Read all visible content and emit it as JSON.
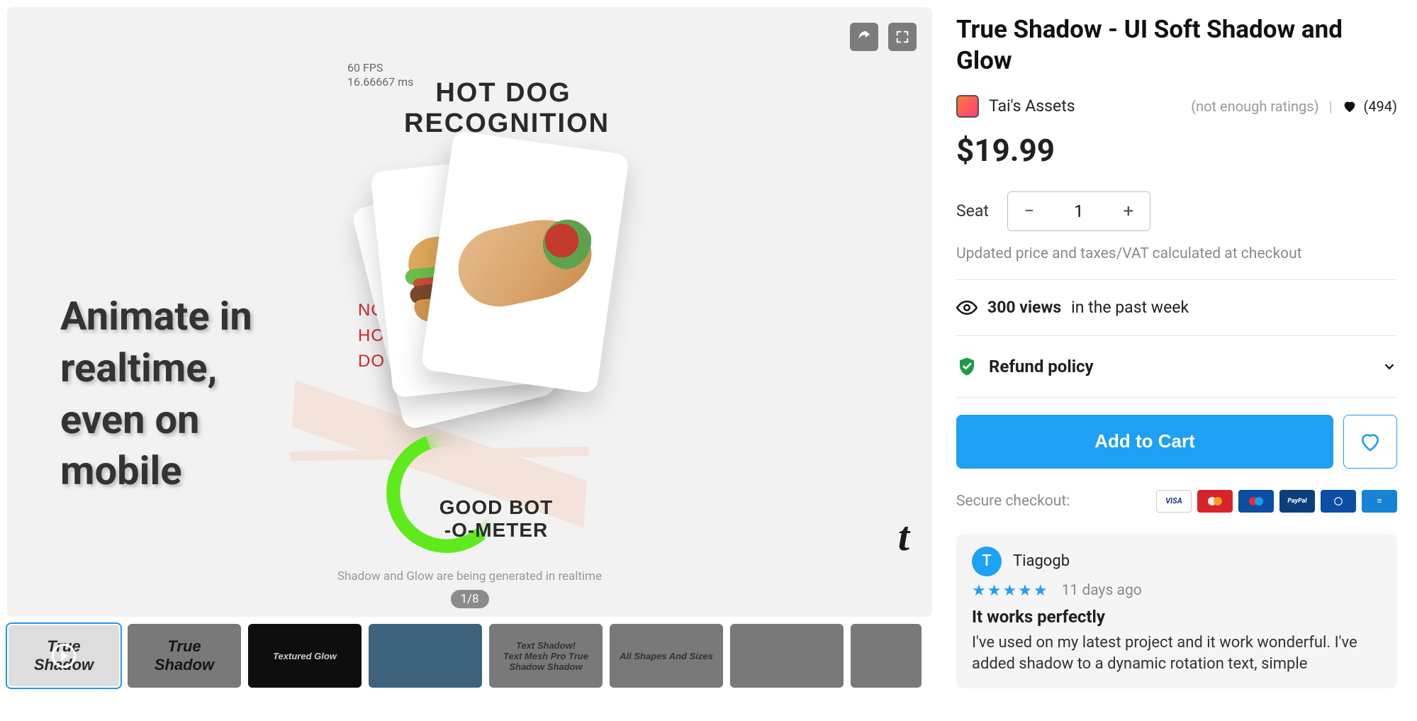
{
  "media": {
    "fps_line1": "60 FPS",
    "fps_line2": "16.66667 ms",
    "pixel_heading": "HOT DOG\nRECOGNITION\nTR",
    "overlay_heading": "Animate in\nrealtime,\neven on\nmobile",
    "red_labels": "NO\nHO\nDO",
    "gauge_label": "GOOD BOT\n-O-METER",
    "caption": "Shadow and Glow are being generated in realtime",
    "watermark": "t",
    "pager": "1/8",
    "share_icon": "share-icon",
    "fullscreen_icon": "fullscreen-icon"
  },
  "thumbnails": [
    {
      "label": "True\nShadow",
      "has_play": true,
      "active": true,
      "style": "light"
    },
    {
      "label": "True\nShadow",
      "has_play": false,
      "active": false,
      "style": "dim"
    },
    {
      "label": "Textured Glow",
      "has_play": false,
      "active": false,
      "style": "dark"
    },
    {
      "label": "",
      "has_play": false,
      "active": false,
      "style": "blue"
    },
    {
      "label": "Text Shadow!\nText Mesh Pro  True\nShadow  Shadow",
      "has_play": false,
      "active": false,
      "style": "dim"
    },
    {
      "label": "All Shapes And Sizes",
      "has_play": false,
      "active": false,
      "style": "dim"
    },
    {
      "label": "",
      "has_play": false,
      "active": false,
      "style": "dim"
    },
    {
      "label": "",
      "has_play": false,
      "active": false,
      "style": "dim-last"
    }
  ],
  "product": {
    "title": "True Shadow - UI Soft Shadow and Glow",
    "publisher": "Tai's Assets",
    "ratings_note": "(not enough ratings)",
    "favorites": "(494)",
    "price": "$19.99",
    "seat_label": "Seat",
    "seat_value": "1",
    "tax_note": "Updated price and taxes/VAT calculated at checkout",
    "views_count": "300 views",
    "views_suffix": "in the past week",
    "refund_label": "Refund policy",
    "add_to_cart": "Add to Cart",
    "secure_label": "Secure checkout:",
    "payment_methods": [
      "VISA",
      "mastercard",
      "maestro",
      "PayPal",
      "diners",
      "AMEX"
    ]
  },
  "review": {
    "avatar_initial": "T",
    "name": "Tiagogb",
    "stars": 5,
    "date": "11 days ago",
    "title": "It works perfectly",
    "body": "I've used on my latest project and it work wonderful. I've added shadow to a dynamic rotation text, simple"
  }
}
